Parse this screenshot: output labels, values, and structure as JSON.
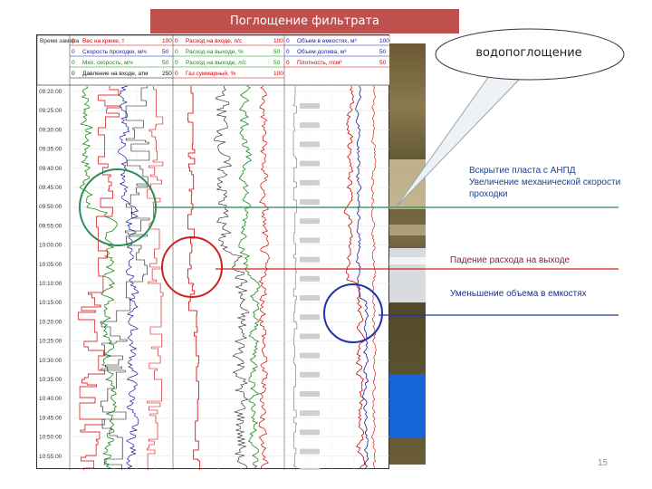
{
  "slide": {
    "title": "Поглощение фильтрата",
    "callout": "водопоглощение",
    "notes": {
      "green": "Вскрытие пласта с АНПД Увеличение механической скорости проходки",
      "red": "Падение расхода на выходе",
      "blue": "Уменьшение объема в емкостях"
    },
    "page_number": "15"
  },
  "log": {
    "time_header": "Время замера",
    "times": [
      "09:20:00",
      "09:25:00",
      "09:30:00",
      "09:35:00",
      "09:40:00",
      "09:45:00",
      "09:50:00",
      "09:55:00",
      "10:00:00",
      "10:05:00",
      "10:10:00",
      "10:15:00",
      "10:20:00",
      "10:25:00",
      "10:30:00",
      "10:35:00",
      "10:40:00",
      "10:45:00",
      "10:50:00",
      "10:55:00",
      "11:00:00"
    ],
    "track1_headers": [
      {
        "label": "Вес на крюке, т",
        "lo": "0",
        "hi": "100",
        "color": "#d00000"
      },
      {
        "label": "Скорость проходки, м/ч",
        "lo": "0",
        "hi": "50",
        "color": "#1a1a9a"
      },
      {
        "label": "Мех. скорость, м/ч",
        "lo": "0",
        "hi": "50",
        "color": "#1a8a1a"
      },
      {
        "label": "Давление на входе, атм",
        "lo": "0",
        "hi": "250",
        "color": "#111111"
      }
    ],
    "track2_headers": [
      {
        "label": "Расход на входе, л/с",
        "lo": "0",
        "hi": "100",
        "color": "#d00000"
      },
      {
        "label": "Расход на выходе, %",
        "lo": "0",
        "hi": "50",
        "color": "#1a8a1a"
      },
      {
        "label": "Расход на выходе, л/с",
        "lo": "0",
        "hi": "50",
        "color": "#1a8a1a"
      },
      {
        "label": "Газ суммарный, %",
        "lo": "0",
        "hi": "100",
        "color": "#d00000"
      }
    ],
    "track3_headers": [
      {
        "label": "Объем в емкостях, м³",
        "lo": "0",
        "hi": "100",
        "color": "#1a1a9a"
      },
      {
        "label": "Объем долива, м³",
        "lo": "0",
        "hi": "50",
        "color": "#1a1a9a"
      },
      {
        "label": "Плотность, г/см³",
        "lo": "0",
        "hi": "50",
        "color": "#d00000"
      }
    ]
  },
  "colors": {
    "title_bg": "#c0504d",
    "green_line": "#2e8b57",
    "red_line": "#cc2222",
    "blue_line": "#2233aa",
    "strip_blue": "#1565d8"
  }
}
